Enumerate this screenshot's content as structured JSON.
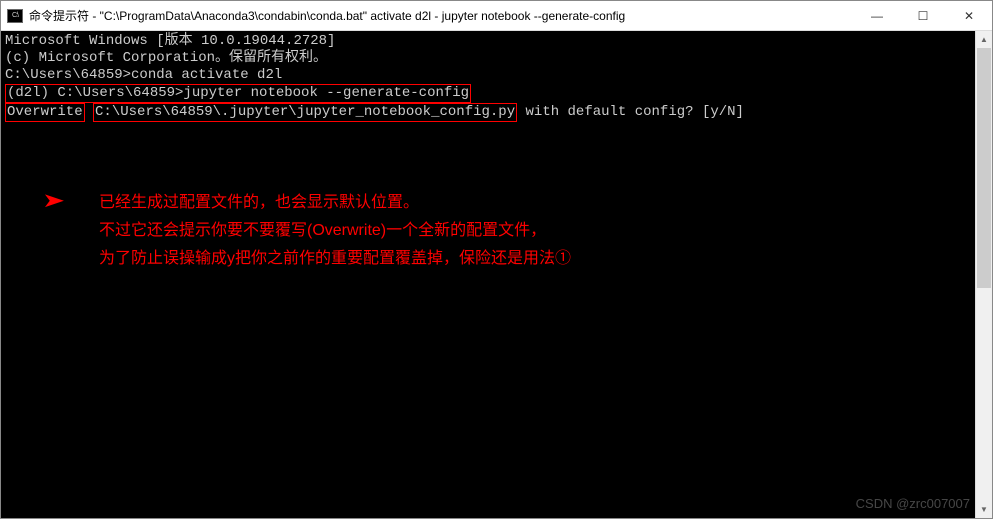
{
  "window": {
    "icon_label": "C:\\",
    "title": "命令提示符 - \"C:\\ProgramData\\Anaconda3\\condabin\\conda.bat\"  activate d2l - jupyter  notebook --generate-config",
    "controls": {
      "minimize": "—",
      "maximize": "☐",
      "close": "✕"
    }
  },
  "terminal": {
    "line1": "Microsoft Windows [版本 10.0.19044.2728]",
    "line2": "(c) Microsoft Corporation。保留所有权利。",
    "line3": "",
    "line4": "C:\\Users\\64859>conda activate d2l",
    "line5": "",
    "boxed_prompt": "(d2l) C:\\Users\\64859>jupyter notebook --generate-config",
    "overwrite_word": "Overwrite",
    "overwrite_path": "C:\\Users\\64859\\.jupyter\\jupyter_notebook_config.py",
    "overwrite_tail": " with default config? [y/N]"
  },
  "annotation": {
    "line1": "已经生成过配置文件的，也会显示默认位置。",
    "line2": "不过它还会提示你要不要覆写(Overwrite)一个全新的配置文件，",
    "line3": "为了防止误操输成y把你之前作的重要配置覆盖掉，保险还是用法①"
  },
  "watermark": "CSDN @zrc007007"
}
